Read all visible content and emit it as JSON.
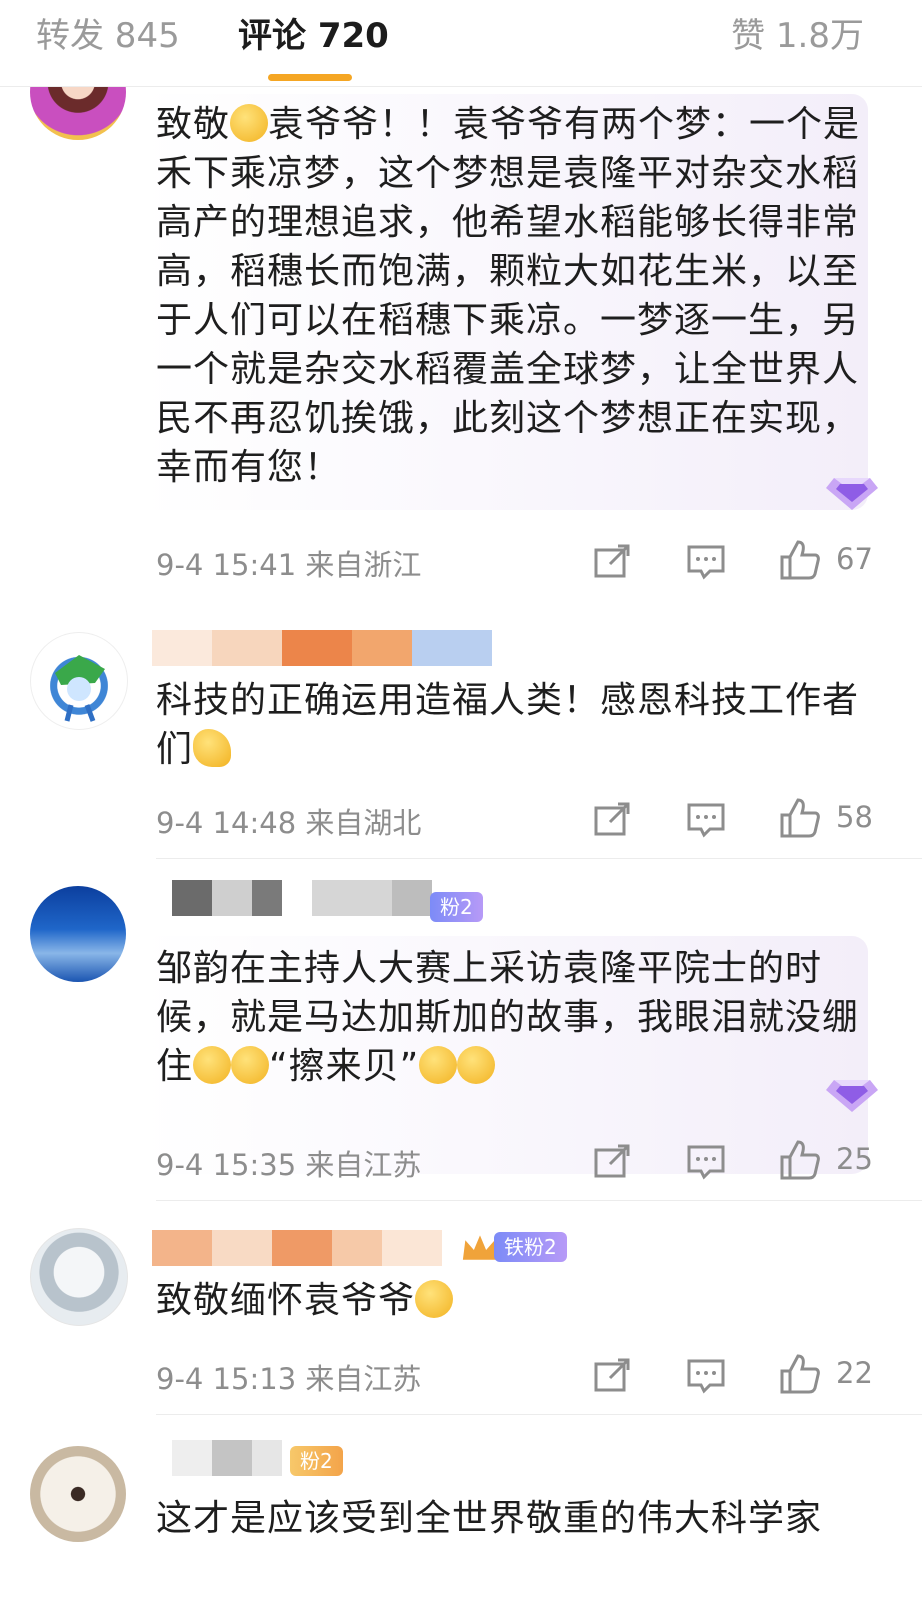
{
  "tabs": {
    "repost": "转发 845",
    "comment": "评论 720",
    "like": "赞 1.8万"
  },
  "comments": [
    {
      "text_a": "致敬",
      "text_b": "袁爷爷！！袁爷爷有两个梦：一个是禾下乘凉梦，这个梦想是袁隆平对杂交水稻高产的理想追求，他希望水稻能够长得非常高，稻穗长而饱满，颗粒大如花生米，以至于人们可以在稻穗下乘凉。一梦逐一生，另一个就是杂交水稻覆盖全球梦，让全世界人民不再忍饥挨饿，此刻这个梦想正在实现，幸而有您！",
      "meta": "9-4 15:41 来自浙江",
      "likes": "67"
    },
    {
      "text_a": "科技的正确运用造福人类！感恩科技工作者们",
      "meta": "9-4 14:48 来自湖北",
      "likes": "58"
    },
    {
      "badge": "粉2",
      "text_a": "邹韵在主持人大赛上采访袁隆平院士的时候，就是马达加斯加的故事，我眼泪就没绷住",
      "text_b": "“擦来贝”",
      "meta": "9-4 15:35 来自江苏",
      "likes": "25"
    },
    {
      "badge": "铁粉2",
      "text_a": "致敬缅怀袁爷爷",
      "meta": "9-4 15:13 来自江苏",
      "likes": "22"
    },
    {
      "badge": "粉2",
      "text_a": "这才是应该受到全世界敬重的伟大科学家"
    }
  ],
  "colors": {
    "tab_accent": "#f5a623",
    "meta_gray": "#8d8d8d",
    "badge_purple": "#9b8cf5"
  }
}
